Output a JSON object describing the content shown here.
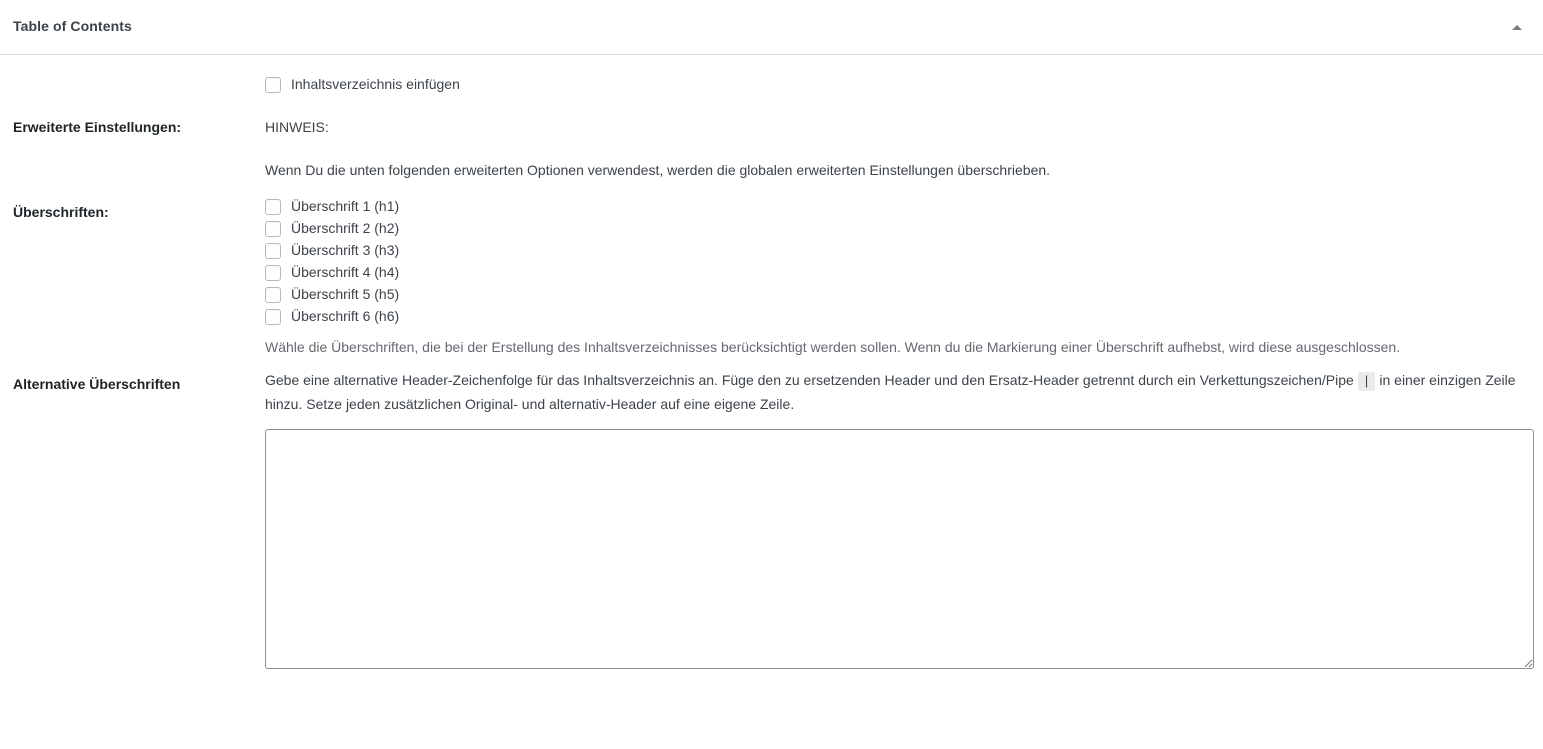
{
  "panel": {
    "title": "Table of Contents",
    "toggle_icon": "caret-up-icon"
  },
  "rows": {
    "toc_insert": {
      "checkbox_label": "Inhaltsverzeichnis einfügen",
      "checked": false
    },
    "advanced": {
      "label": "Erweiterte Einstellungen:",
      "note_title": "HINWEIS:",
      "note_body": "Wenn Du die unten folgenden erweiterten Optionen verwendest, werden die globalen erweiterten Einstellungen überschrieben."
    },
    "headings": {
      "label": "Überschriften:",
      "items": [
        {
          "label": "Überschrift 1 (h1)",
          "checked": false
        },
        {
          "label": "Überschrift 2 (h2)",
          "checked": false
        },
        {
          "label": "Überschrift 3 (h3)",
          "checked": false
        },
        {
          "label": "Überschrift 4 (h4)",
          "checked": false
        },
        {
          "label": "Überschrift 5 (h5)",
          "checked": false
        },
        {
          "label": "Überschrift 6 (h6)",
          "checked": false
        }
      ],
      "description": "Wähle die Überschriften, die bei der Erstellung des Inhaltsverzeichnisses berücksichtigt werden sollen. Wenn du die Markierung einer Überschrift aufhebst, wird diese ausgeschlossen."
    },
    "alt_headings": {
      "label": "Alternative Überschriften",
      "description_part1": "Gebe eine alternative Header-Zeichenfolge für das Inhaltsverzeichnis an. Füge den zu ersetzenden Header und den Ersatz-Header getrennt durch ein Verkettungszeichen/Pipe",
      "description_code": "|",
      "description_part2": "in einer einzigen Zeile hinzu. Setze jeden zusätzlichen Original- und alternativ-Header auf eine eigene Zeile.",
      "textarea_value": "",
      "textarea_placeholder": ""
    }
  },
  "colors": {
    "text": "#3c434a",
    "heading": "#1d2327",
    "muted": "#646970",
    "border": "#dcdcde",
    "field_border": "#8c8f94",
    "code_bg": "#eaeaea"
  }
}
